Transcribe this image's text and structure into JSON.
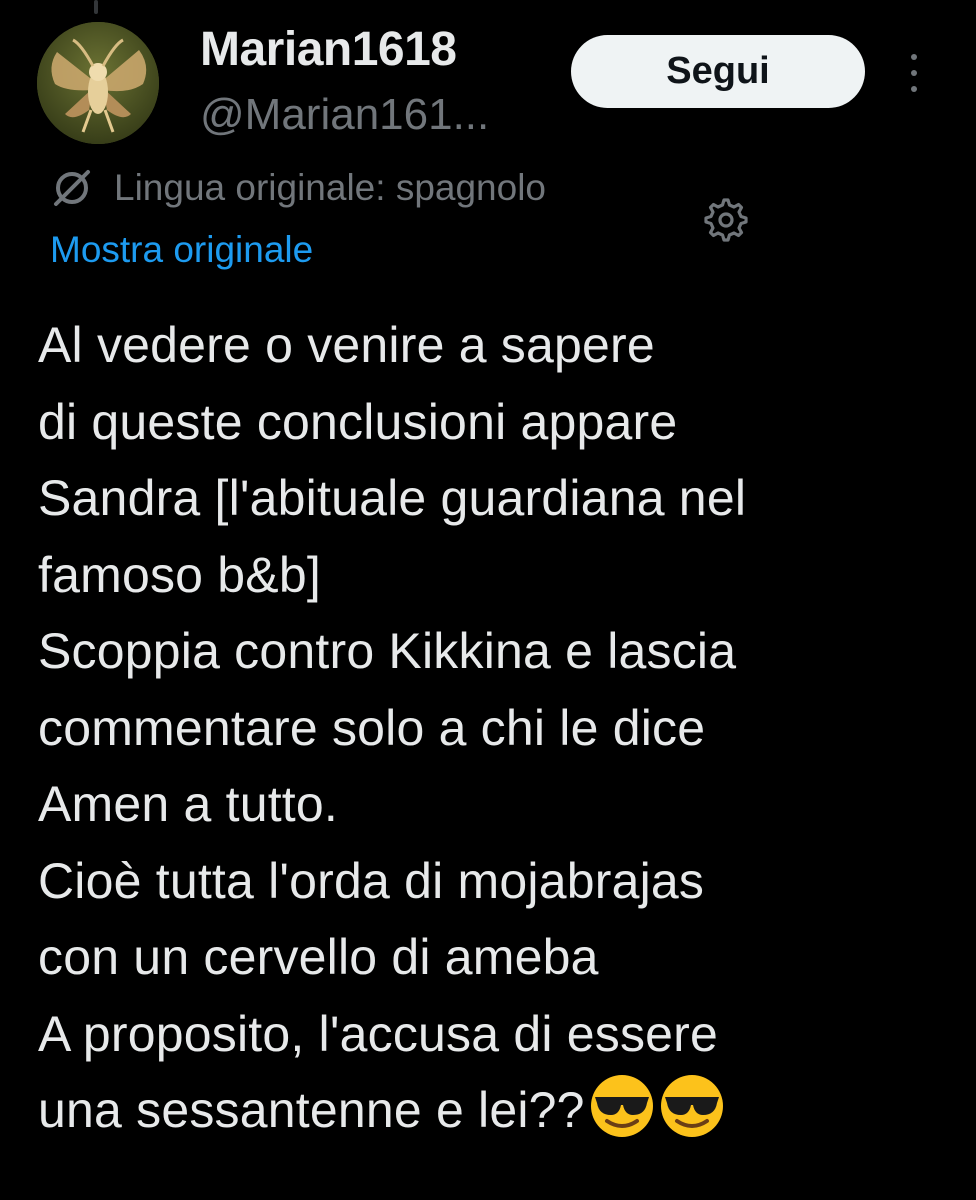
{
  "author": {
    "display_name": "Marian1618",
    "handle": "@Marian161..."
  },
  "actions": {
    "follow_label": "Segui"
  },
  "icons": {
    "more": "more-icon",
    "translate": "translate-icon",
    "settings": "gear-icon",
    "emoji": "sunglasses-emoji"
  },
  "translation": {
    "notice": "Lingua originale: spagnolo",
    "show_original": "Mostra originale"
  },
  "tweet": {
    "text": "Al vedere o venire a sapere\ndi queste conclusioni appare\nSandra [l'abituale guardiana nel\nfamoso b&b]\nScoppia contro Kikkina e lascia\ncommentare solo a chi le dice\nAmen a tutto.\nCioè tutta l'orda di mojabrajas\ncon un cervello di ameba\nA proposito, l'accusa di essere\nuna sessantenne e lei??",
    "emoji": "😎😎"
  },
  "colors": {
    "background": "#000000",
    "text_primary": "#e7e9ea",
    "text_secondary": "#71767b",
    "link": "#1d9bf0",
    "button_bg": "#eff3f4"
  }
}
